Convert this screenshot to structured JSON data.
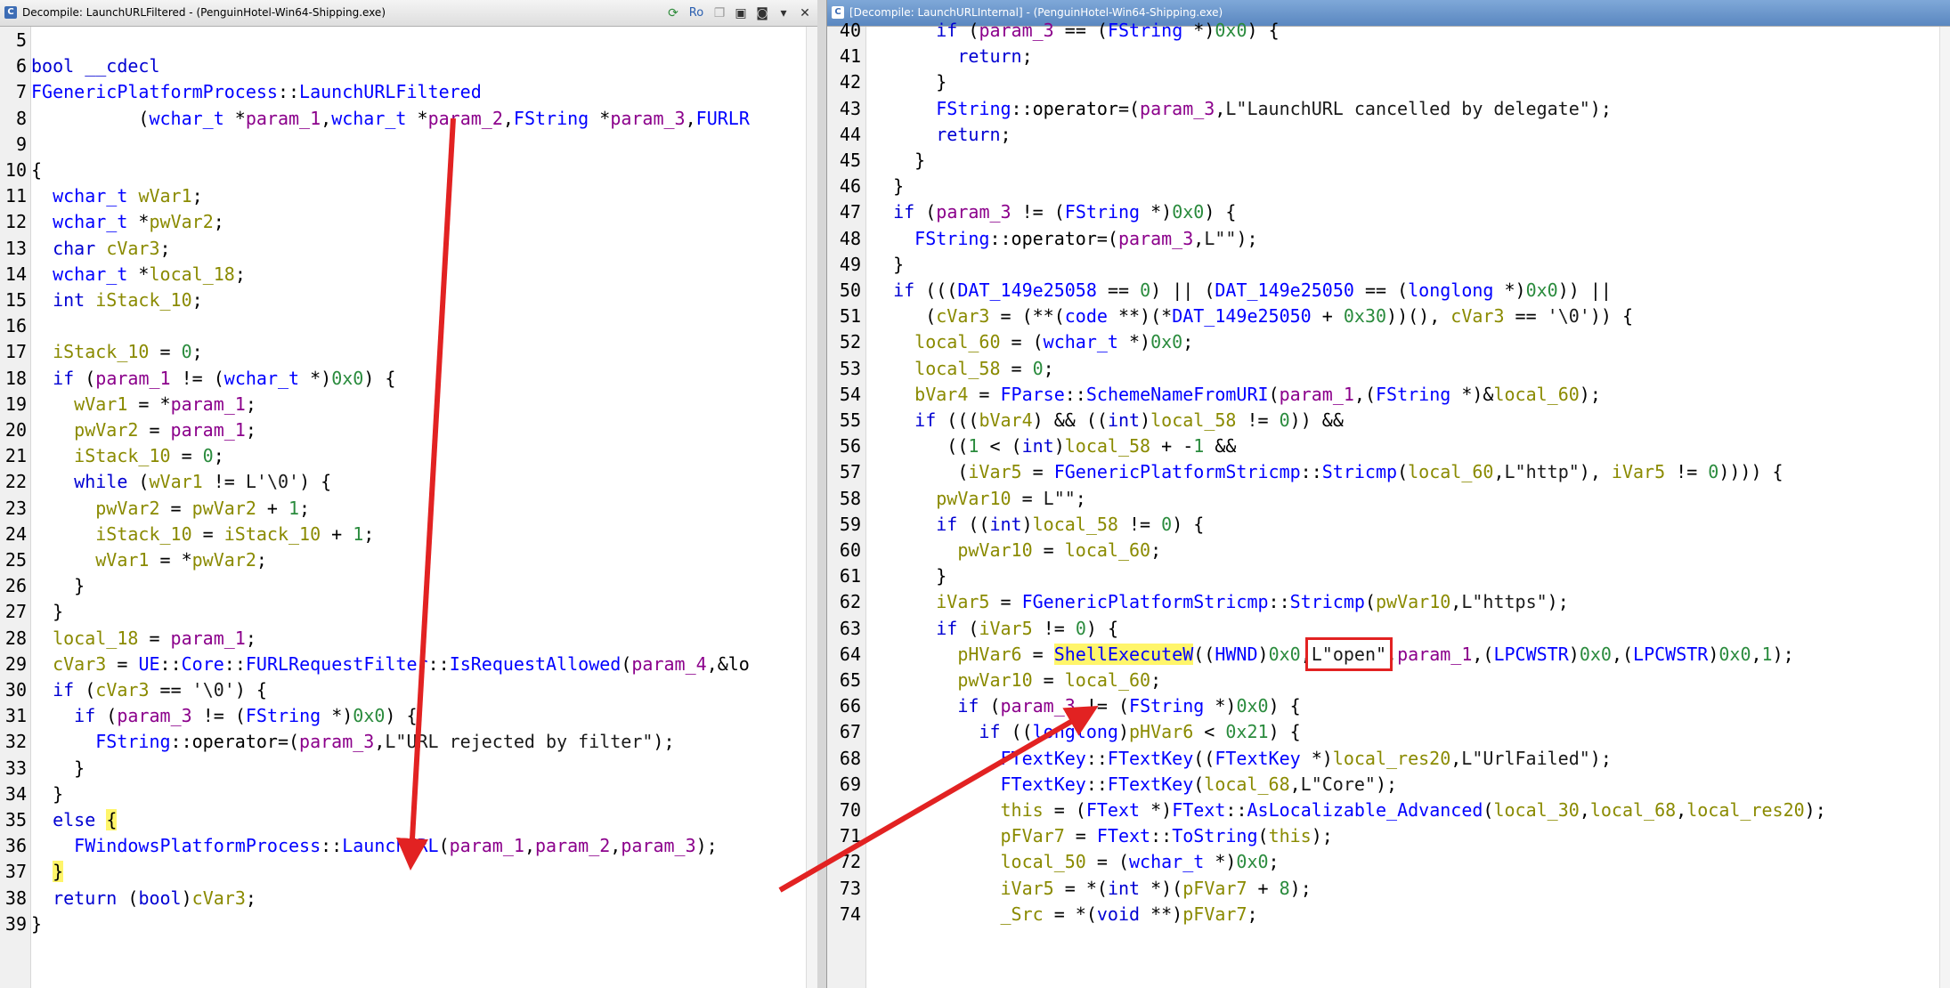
{
  "left_window": {
    "title": "Decompile: LaunchURLFiltered -  (PenguinHotel-Win64-Shipping.exe)",
    "toolbar_icons": [
      "refresh-icon",
      "read-only-icon",
      "copy-icon",
      "snapshot-icon",
      "camera-icon",
      "dropdown-icon",
      "close-icon"
    ],
    "toolbar_ro_label": "Ro",
    "lines": [
      {
        "n": "5",
        "code": ""
      },
      {
        "n": "6",
        "code": "bool __cdecl"
      },
      {
        "n": "7",
        "code": "FGenericPlatformProcess::LaunchURLFiltered"
      },
      {
        "n": "8",
        "code": "          (wchar_t *param_1,wchar_t *param_2,FString *param_3,FURLR"
      },
      {
        "n": "9",
        "code": ""
      },
      {
        "n": "10",
        "code": "{"
      },
      {
        "n": "11",
        "code": "  wchar_t wVar1;"
      },
      {
        "n": "12",
        "code": "  wchar_t *pwVar2;"
      },
      {
        "n": "13",
        "code": "  char cVar3;"
      },
      {
        "n": "14",
        "code": "  wchar_t *local_18;"
      },
      {
        "n": "15",
        "code": "  int iStack_10;"
      },
      {
        "n": "16",
        "code": ""
      },
      {
        "n": "17",
        "code": "  iStack_10 = 0;"
      },
      {
        "n": "18",
        "code": "  if (param_1 != (wchar_t *)0x0) {"
      },
      {
        "n": "19",
        "code": "    wVar1 = *param_1;"
      },
      {
        "n": "20",
        "code": "    pwVar2 = param_1;"
      },
      {
        "n": "21",
        "code": "    iStack_10 = 0;"
      },
      {
        "n": "22",
        "code": "    while (wVar1 != L'\\0') {"
      },
      {
        "n": "23",
        "code": "      pwVar2 = pwVar2 + 1;"
      },
      {
        "n": "24",
        "code": "      iStack_10 = iStack_10 + 1;"
      },
      {
        "n": "25",
        "code": "      wVar1 = *pwVar2;"
      },
      {
        "n": "26",
        "code": "    }"
      },
      {
        "n": "27",
        "code": "  }"
      },
      {
        "n": "28",
        "code": "  local_18 = param_1;"
      },
      {
        "n": "29",
        "code": "  cVar3 = UE::Core::FURLRequestFilter::IsRequestAllowed(param_4,&lo"
      },
      {
        "n": "30",
        "code": "  if (cVar3 == '\\0') {"
      },
      {
        "n": "31",
        "code": "    if (param_3 != (FString *)0x0) {"
      },
      {
        "n": "32",
        "code": "      FString::operator=(param_3,L\"URL rejected by filter\");"
      },
      {
        "n": "33",
        "code": "    }"
      },
      {
        "n": "34",
        "code": "  }"
      },
      {
        "n": "35",
        "code": "  else {"
      },
      {
        "n": "36",
        "code": "    FWindowsPlatformProcess::LaunchURL(param_1,param_2,param_3);"
      },
      {
        "n": "37",
        "code": "  }"
      },
      {
        "n": "38",
        "code": "  return (bool)cVar3;"
      },
      {
        "n": "39",
        "code": "}"
      }
    ]
  },
  "right_window": {
    "title": "[Decompile: LaunchURLInternal] -  (PenguinHotel-Win64-Shipping.exe)",
    "lines": [
      {
        "n": "40",
        "code": "      if (param_3 == (FString *)0x0) {"
      },
      {
        "n": "41",
        "code": "        return;"
      },
      {
        "n": "42",
        "code": "      }"
      },
      {
        "n": "43",
        "code": "      FString::operator=(param_3,L\"LaunchURL cancelled by delegate\");"
      },
      {
        "n": "44",
        "code": "      return;"
      },
      {
        "n": "45",
        "code": "    }"
      },
      {
        "n": "46",
        "code": "  }"
      },
      {
        "n": "47",
        "code": "  if (param_3 != (FString *)0x0) {"
      },
      {
        "n": "48",
        "code": "    FString::operator=(param_3,L\"\");"
      },
      {
        "n": "49",
        "code": "  }"
      },
      {
        "n": "50",
        "code": "  if (((DAT_149e25058 == 0) || (DAT_149e25050 == (longlong *)0x0)) ||"
      },
      {
        "n": "51",
        "code": "     (cVar3 = (**(code **)(*DAT_149e25050 + 0x30))(), cVar3 == '\\0')) {"
      },
      {
        "n": "52",
        "code": "    local_60 = (wchar_t *)0x0;"
      },
      {
        "n": "53",
        "code": "    local_58 = 0;"
      },
      {
        "n": "54",
        "code": "    bVar4 = FParse::SchemeNameFromURI(param_1,(FString *)&local_60);"
      },
      {
        "n": "55",
        "code": "    if (((bVar4) && ((int)local_58 != 0)) &&"
      },
      {
        "n": "56",
        "code": "       ((1 < (int)local_58 + -1 &&"
      },
      {
        "n": "57",
        "code": "        (iVar5 = FGenericPlatformStricmp::Stricmp(local_60,L\"http\"), iVar5 != 0)))) {"
      },
      {
        "n": "58",
        "code": "      pwVar10 = L\"\";"
      },
      {
        "n": "59",
        "code": "      if ((int)local_58 != 0) {"
      },
      {
        "n": "60",
        "code": "        pwVar10 = local_60;"
      },
      {
        "n": "61",
        "code": "      }"
      },
      {
        "n": "62",
        "code": "      iVar5 = FGenericPlatformStricmp::Stricmp(pwVar10,L\"https\");"
      },
      {
        "n": "63",
        "code": "      if (iVar5 != 0) {"
      },
      {
        "n": "64",
        "code": "        pHVar6 = ShellExecuteW((HWND)0x0,L\"open\",param_1,(LPCWSTR)0x0,(LPCWSTR)0x0,1);"
      },
      {
        "n": "65",
        "code": "        pwVar10 = local_60;"
      },
      {
        "n": "66",
        "code": "        if (param_3 != (FString *)0x0) {"
      },
      {
        "n": "67",
        "code": "          if ((longlong)pHVar6 < 0x21) {"
      },
      {
        "n": "68",
        "code": "            FTextKey::FTextKey((FTextKey *)local_res20,L\"UrlFailed\");"
      },
      {
        "n": "69",
        "code": "            FTextKey::FTextKey(local_68,L\"Core\");"
      },
      {
        "n": "70",
        "code": "            this = (FText *)FText::AsLocalizable_Advanced(local_30,local_68,local_res20);"
      },
      {
        "n": "71",
        "code": "            pFVar7 = FText::ToString(this);"
      },
      {
        "n": "72",
        "code": "            local_50 = (wchar_t *)0x0;"
      },
      {
        "n": "73",
        "code": "            iVar5 = *(int *)(pFVar7 + 8);"
      },
      {
        "n": "74",
        "code": "            _Src = *(void **)pFVar7;"
      }
    ]
  },
  "colors": {
    "arrow": "#e22222",
    "keyword": "#0000d2",
    "function": "#0000ff",
    "param": "#8b008b",
    "global": "#8a8a00",
    "number": "#2a8b3d",
    "highlight": "#fff56a"
  }
}
